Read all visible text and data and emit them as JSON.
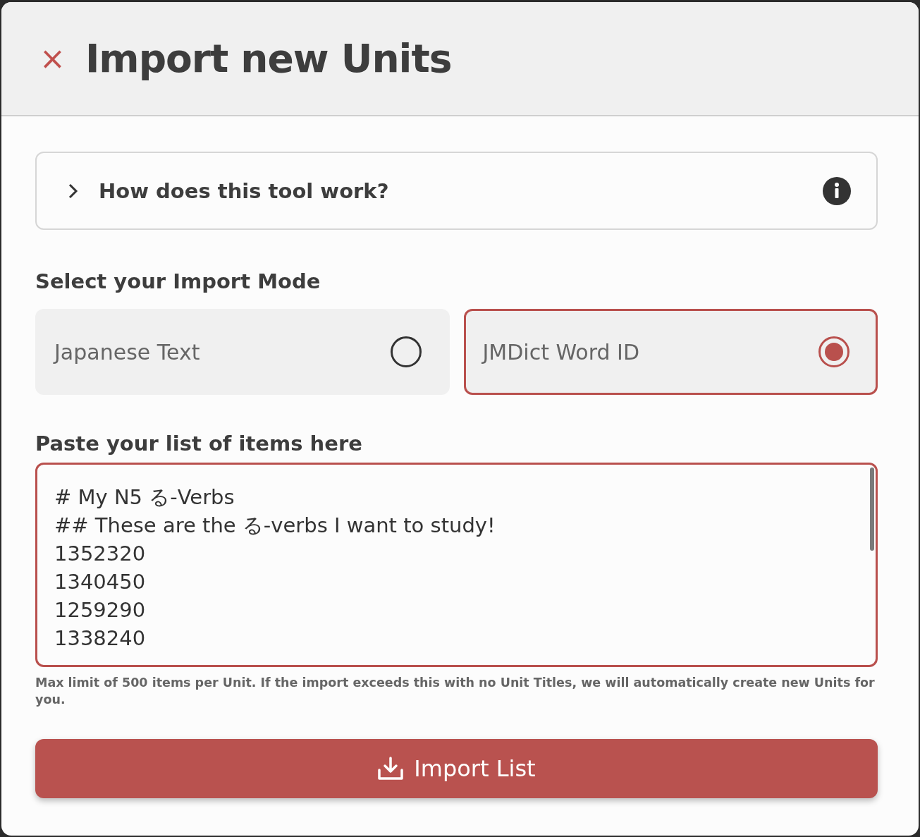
{
  "dialog": {
    "title": "Import new Units",
    "close_icon": "×"
  },
  "help": {
    "label": "How does this tool work?",
    "expanded": false
  },
  "mode": {
    "heading": "Select your Import Mode",
    "options": [
      {
        "label": "Japanese Text",
        "selected": false
      },
      {
        "label": "JMDict Word ID",
        "selected": true
      }
    ]
  },
  "list": {
    "heading": "Paste your list of items here",
    "value": "# My N5 る-Verbs\n## These are the る-verbs I want to study!\n1352320\n1340450\n1259290\n1338240",
    "note": "Max limit of 500 items per Unit. If the import exceeds this with no Unit Titles, we will automatically create new Units for you."
  },
  "button": {
    "label": "Import List"
  }
}
